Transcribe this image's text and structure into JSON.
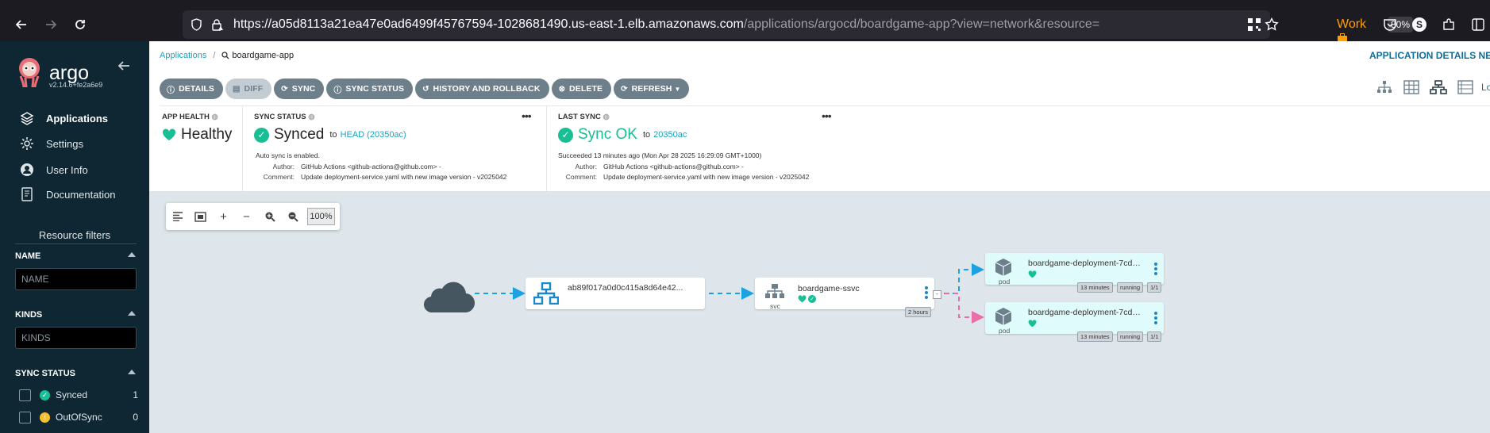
{
  "browser": {
    "url_main": "https://a05d8113a21ea47e0ad6499f45767594-1028681490.us-east-1.elb.amazonaws.com",
    "url_path": "/applications/argocd/boardgame-app?view=network&resource=",
    "container_label": "Work",
    "zoom": "80%",
    "profile_initial": "S"
  },
  "sidebar": {
    "brand": "argo",
    "version": "v2.14.6+fe2a6e9",
    "nav": [
      {
        "label": "Applications",
        "icon": "layers-icon"
      },
      {
        "label": "Settings",
        "icon": "gear-icon"
      },
      {
        "label": "User Info",
        "icon": "user-icon"
      },
      {
        "label": "Documentation",
        "icon": "book-icon"
      }
    ],
    "filters_title": "Resource filters",
    "name_label": "NAME",
    "name_placeholder": "NAME",
    "kinds_label": "KINDS",
    "kinds_placeholder": "KINDS",
    "sync_label": "SYNC STATUS",
    "sync_items": [
      {
        "label": "Synced",
        "count": "1",
        "color": "#18be94"
      },
      {
        "label": "OutOfSync",
        "count": "0",
        "color": "#f4c030"
      }
    ]
  },
  "header": {
    "breadcrumb_root": "Applications",
    "breadcrumb_current": "boardgame-app",
    "details_title": "APPLICATION DETAILS NETW",
    "view_more": "Lo"
  },
  "toolbar": {
    "details": "DETAILS",
    "diff": "DIFF",
    "sync": "SYNC",
    "sync_status": "SYNC STATUS",
    "history": "HISTORY AND ROLLBACK",
    "delete": "DELETE",
    "refresh": "REFRESH"
  },
  "status": {
    "health_head": "APP HEALTH",
    "health_value": "Healthy",
    "sync_head": "SYNC STATUS",
    "sync_value": "Synced",
    "sync_to": "to",
    "sync_rev": "HEAD (20350ac)",
    "auto_sync": "Auto sync is enabled.",
    "author_key": "Author:",
    "author_val": "GitHub Actions <github-actions@github.com> -",
    "comment_key": "Comment:",
    "comment_val": "Update deployment-service.yaml with new image version - v2025042",
    "last_head": "LAST SYNC",
    "last_value": "Sync OK",
    "last_to": "to",
    "last_rev": "20350ac",
    "last_time": "Succeeded 13 minutes ago (Mon Apr 28 2025 16:29:09 GMT+1000)",
    "last_author_val": "GitHub Actions <github-actions@github.com> -",
    "last_comment_val": "Update deployment-service.yaml with new image version - v2025042"
  },
  "graph": {
    "zoom": "100%",
    "ingress_label": "ab89f017a0d0c415a8d64e42...",
    "svc_label": "boardgame-ssvc",
    "svc_kind": "svc",
    "svc_age": "2 hours",
    "pods": [
      {
        "label": "boardgame-deployment-7cdb...",
        "kind": "pod",
        "age": "13 minutes",
        "state": "running",
        "ready": "1/1"
      },
      {
        "label": "boardgame-deployment-7cdb...",
        "kind": "pod",
        "age": "13 minutes",
        "state": "running",
        "ready": "1/1"
      }
    ]
  }
}
